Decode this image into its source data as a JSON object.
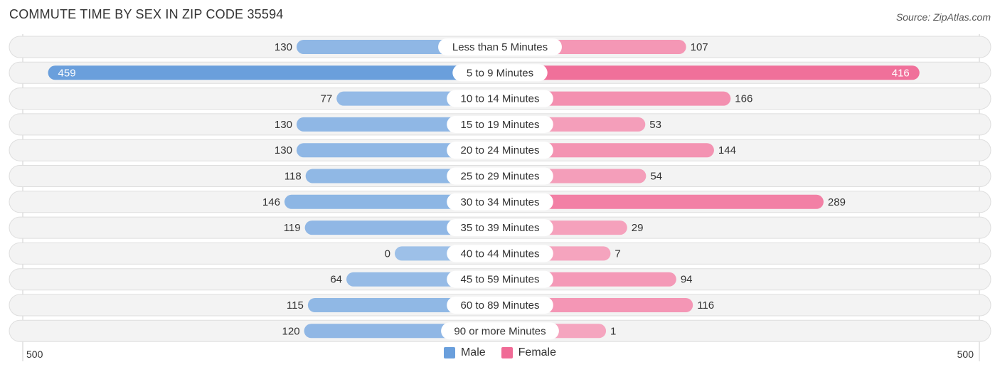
{
  "header": {
    "title": "COMMUTE TIME BY SEX IN ZIP CODE 35594",
    "source": "Source: ZipAtlas.com"
  },
  "colors": {
    "male": "#6a9fdc",
    "male_light": "#9dc0e8",
    "female": "#f06b96",
    "female_light": "#f5a5bf",
    "row_bg": "#f3f3f3"
  },
  "chart_data": {
    "type": "bar",
    "orientation": "horizontal-diverging",
    "title": "COMMUTE TIME BY SEX IN ZIP CODE 35594",
    "categories": [
      "Less than 5 Minutes",
      "5 to 9 Minutes",
      "10 to 14 Minutes",
      "15 to 19 Minutes",
      "20 to 24 Minutes",
      "25 to 29 Minutes",
      "30 to 34 Minutes",
      "35 to 39 Minutes",
      "40 to 44 Minutes",
      "45 to 59 Minutes",
      "60 to 89 Minutes",
      "90 or more Minutes"
    ],
    "series": [
      {
        "name": "Male",
        "values": [
          130,
          459,
          77,
          130,
          130,
          118,
          146,
          119,
          0,
          64,
          115,
          120
        ]
      },
      {
        "name": "Female",
        "values": [
          107,
          416,
          166,
          53,
          144,
          54,
          289,
          29,
          7,
          94,
          116,
          1
        ]
      }
    ],
    "axis": {
      "left_tick": "500",
      "right_tick": "500",
      "range": [
        -500,
        500
      ]
    },
    "legend": {
      "position": "bottom-center",
      "entries": [
        "Male",
        "Female"
      ]
    },
    "grid": false
  }
}
